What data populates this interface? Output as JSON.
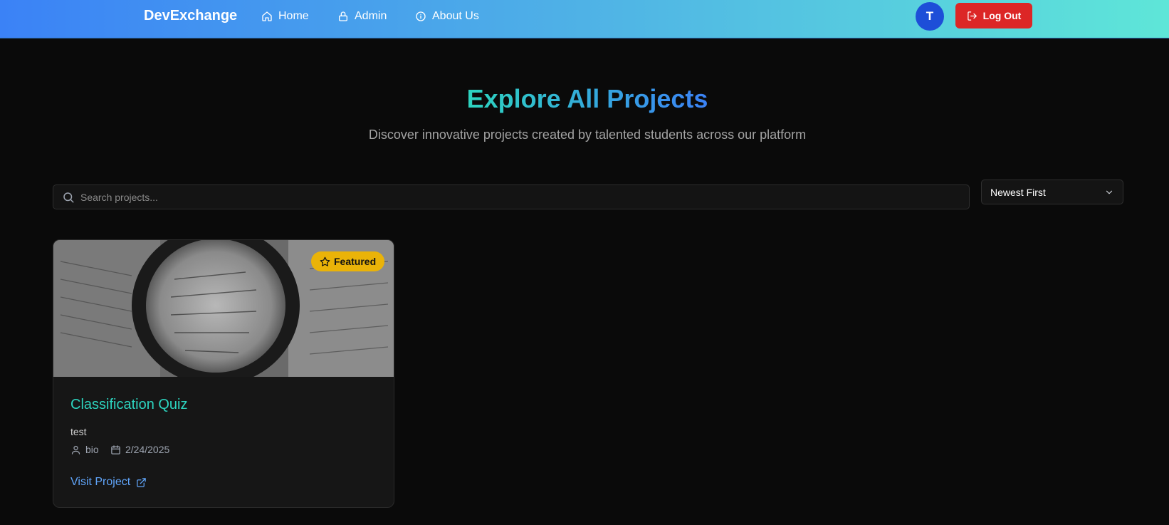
{
  "header": {
    "brand": "DevExchange",
    "nav": {
      "home": "Home",
      "admin": "Admin",
      "about": "About Us"
    },
    "avatar_initial": "T",
    "logout_label": "Log Out"
  },
  "hero": {
    "title": "Explore All Projects",
    "subtitle": "Discover innovative projects created by talented students across our platform"
  },
  "search": {
    "placeholder": "Search projects..."
  },
  "sort": {
    "selected": "Newest First"
  },
  "projects": [
    {
      "badge": "Featured",
      "title": "Classification Quiz",
      "description": "test",
      "author": "bio",
      "date": "2/24/2025",
      "link_label": "Visit Project"
    }
  ],
  "colors": {
    "accent_teal": "#2dd4bf",
    "accent_blue": "#3b82f6",
    "logout_red": "#dc2626",
    "badge_yellow": "#eab308",
    "link_blue": "#60a5fa"
  },
  "icons": {
    "home": "home-icon",
    "admin": "lock-icon",
    "about": "info-icon",
    "logout": "logout-icon",
    "search": "search-icon",
    "sort": "chevron-down-icon",
    "badge": "star-icon",
    "author": "user-icon",
    "date": "calendar-icon",
    "visit": "external-link-icon"
  }
}
